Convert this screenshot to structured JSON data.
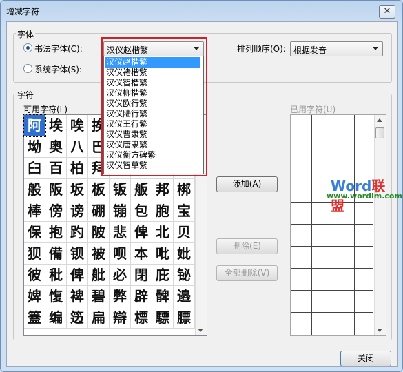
{
  "window": {
    "title": "增减字符",
    "close_glyph": "✕"
  },
  "font_group": {
    "label": "字体",
    "radio_calligraphy": "书法字体(C):",
    "radio_system": "系统字体(S):",
    "selected_font": "汉仪赵楷繁"
  },
  "sort": {
    "label": "排列顺序(O):",
    "value": "根据发音"
  },
  "dropdown": {
    "items": [
      "汉仪赵楷繁",
      "汉仪褚楷繁",
      "汉仪智楷繁",
      "汉仪柳楷繁",
      "汉仪欧行繁",
      "汉仪陆行繁",
      "汉仪王行繁",
      "汉仪曹隶繁",
      "汉仪唐隶繁",
      "汉仪衡方碑繁",
      "汉仪智草繁"
    ],
    "highlighted": "汉仪赵楷繁"
  },
  "chars_group": {
    "label": "字符",
    "available_label": "可用字符(L)",
    "used_label": "已用字符(U)",
    "rows": [
      [
        "阿",
        "埃",
        "唉",
        "挨",
        "",
        "",
        "",
        "",
        ""
      ],
      [
        "坳",
        "奥",
        "八",
        "巴",
        "",
        "",
        "",
        "",
        ""
      ],
      [
        "臼",
        "百",
        "柏",
        "拜",
        "",
        "",
        "",
        "",
        ""
      ],
      [
        "般",
        "阪",
        "坂",
        "板",
        "钣",
        "舨",
        "邦",
        "梆"
      ],
      [
        "棒",
        "傍",
        "谤",
        "硼",
        "镚",
        "包",
        "胞",
        "宝"
      ],
      [
        "保",
        "抱",
        "趵",
        "陂",
        "悲",
        "俾",
        "北",
        "贝"
      ],
      [
        "狈",
        "備",
        "钡",
        "被",
        "呗",
        "本",
        "吡",
        "妣"
      ],
      [
        "彼",
        "秕",
        "俾",
        "舭",
        "必",
        "閉",
        "庇",
        "铋"
      ],
      [
        "婢",
        "愎",
        "裨",
        "碧",
        "弊",
        "辟",
        "髀",
        "邉"
      ],
      [
        "篕",
        "编",
        "笾",
        "扁",
        "辯",
        "標",
        "驃",
        "膘"
      ]
    ]
  },
  "buttons": {
    "add": "添加(A)",
    "delete": "删除(E)",
    "delete_all": "全部删除(V)",
    "close": "关闭"
  },
  "watermark": {
    "brand_w": "W",
    "brand_ord": "ord",
    "brand_cn": "联盟",
    "url": "www.wordlm.com"
  },
  "colors": {
    "accent_selection": "#3399ff",
    "annotation_red": "#d0202a"
  }
}
